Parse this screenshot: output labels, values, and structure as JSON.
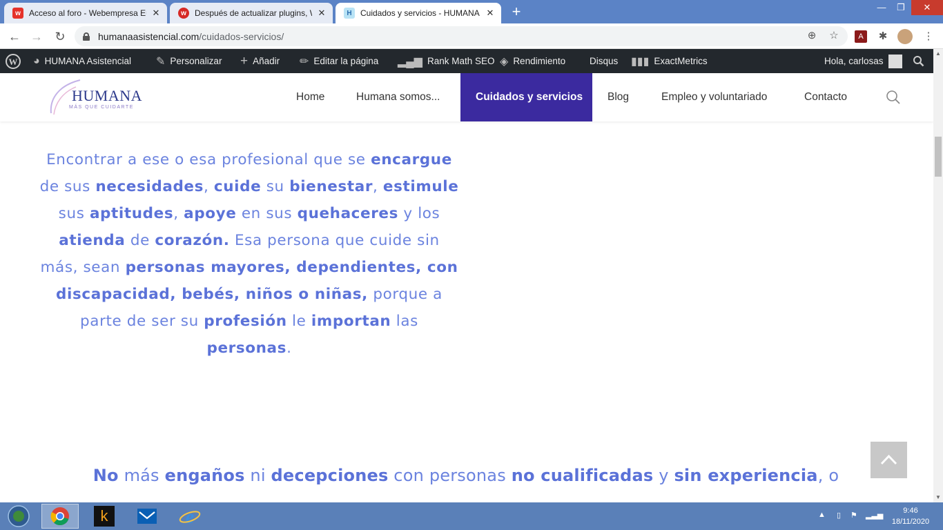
{
  "browser": {
    "tabs": [
      {
        "title": "Acceso al foro - Webempresa Eu",
        "favicon_color": "#e5312a"
      },
      {
        "title": "Después de actualizar plugins, W",
        "favicon_color": "#d62a26"
      },
      {
        "title": "Cuidados y servicios - HUMANA",
        "favicon_color": "#b9e3f5",
        "active": true
      }
    ],
    "url_host": "humanaasistencial.com",
    "url_path": "/cuidados-servicios/"
  },
  "adminbar": {
    "site": "HUMANA Asistencial",
    "customize": "Personalizar",
    "add": "Añadir",
    "edit": "Editar la página",
    "rankmath": "Rank Math SEO",
    "performance": "Rendimiento",
    "disqus": "Disqus",
    "exactmetrics": "ExactMetrics",
    "greeting": "Hola, carlosas"
  },
  "site": {
    "logo_word": "HUMANA",
    "logo_tag": "MÁS QUE CUIDARTE",
    "nav": [
      "Home",
      "Humana somos...",
      "Cuidados y servicios",
      "Blog",
      "Empleo y voluntariado",
      "Contacto"
    ]
  },
  "content": {
    "p1": [
      {
        "t": "Encontrar a ese o esa profesional que se ",
        "b": false
      },
      {
        "t": "encargue",
        "b": true
      },
      {
        "t": " de sus ",
        "b": false
      },
      {
        "t": "necesidades",
        "b": true
      },
      {
        "t": ", ",
        "b": false
      },
      {
        "t": "cuide",
        "b": true
      },
      {
        "t": " su ",
        "b": false
      },
      {
        "t": "bienestar",
        "b": true
      },
      {
        "t": ", ",
        "b": false
      },
      {
        "t": "estimule",
        "b": true
      },
      {
        "t": " sus ",
        "b": false
      },
      {
        "t": "aptitudes",
        "b": true
      },
      {
        "t": ", ",
        "b": false
      },
      {
        "t": "apoye",
        "b": true
      },
      {
        "t": " en sus ",
        "b": false
      },
      {
        "t": "quehaceres",
        "b": true
      },
      {
        "t": " y los ",
        "b": false
      },
      {
        "t": "atienda",
        "b": true
      },
      {
        "t": " de ",
        "b": false
      },
      {
        "t": "corazón.",
        "b": true
      },
      {
        "t": " Esa persona que cuide sin más, sean ",
        "b": false
      },
      {
        "t": "personas mayores, dependientes, con discapacidad, bebés, niños o niñas,",
        "b": true
      },
      {
        "t": " porque a parte de ser su ",
        "b": false
      },
      {
        "t": "profesión",
        "b": true
      },
      {
        "t": " le ",
        "b": false
      },
      {
        "t": "importan",
        "b": true
      },
      {
        "t": " las ",
        "b": false
      },
      {
        "t": "personas",
        "b": true
      },
      {
        "t": ".",
        "b": false
      }
    ],
    "p2": [
      {
        "t": "No",
        "b": true
      },
      {
        "t": " más ",
        "b": false
      },
      {
        "t": "engaños",
        "b": true
      },
      {
        "t": " ni ",
        "b": false
      },
      {
        "t": "decepciones",
        "b": true
      },
      {
        "t": " con personas ",
        "b": false
      },
      {
        "t": "no cualificadas",
        "b": true
      },
      {
        "t": " y ",
        "b": false
      },
      {
        "t": "sin experiencia",
        "b": true
      },
      {
        "t": ", o",
        "b": false
      }
    ]
  },
  "taskbar": {
    "time": "9:46",
    "date": "18/11/2020"
  }
}
